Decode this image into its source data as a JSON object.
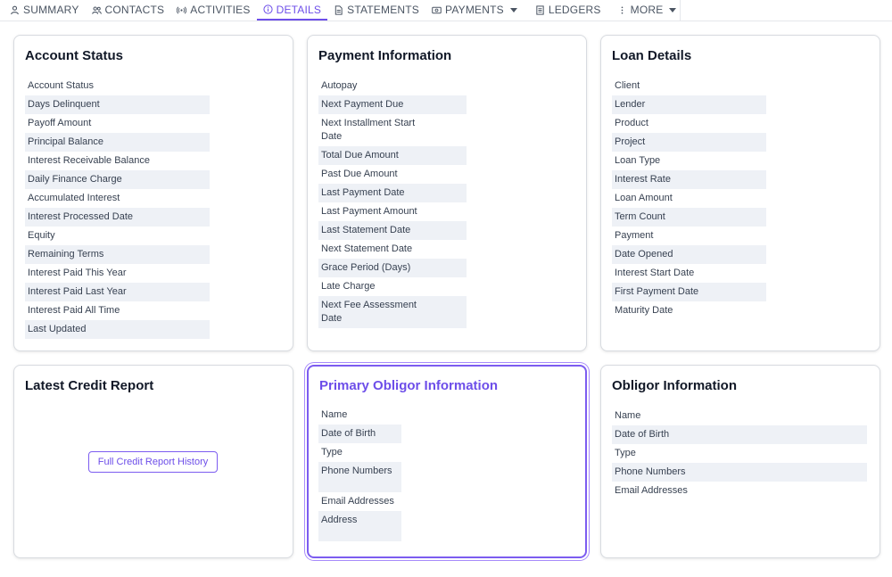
{
  "nav": {
    "tabs": [
      {
        "label": "SUMMARY"
      },
      {
        "label": "CONTACTS"
      },
      {
        "label": "ACTIVITIES"
      },
      {
        "label": "DETAILS"
      },
      {
        "label": "STATEMENTS"
      },
      {
        "label": "PAYMENTS"
      },
      {
        "label": "LEDGERS"
      },
      {
        "label": "MORE"
      }
    ]
  },
  "account_status": {
    "title": "Account Status",
    "fields": [
      "Account Status",
      "Days Delinquent",
      "Payoff Amount",
      "Principal Balance",
      "Interest Receivable Balance",
      "Daily Finance Charge",
      "Accumulated Interest",
      "Interest Processed Date",
      "Equity",
      "Remaining Terms",
      "Interest Paid This Year",
      "Interest Paid Last Year",
      "Interest Paid All Time",
      "Last Updated"
    ]
  },
  "payment_information": {
    "title": "Payment Information",
    "fields": [
      "Autopay",
      "Next Payment Due",
      "Next Installment Start Date",
      "Total Due Amount",
      "Past Due Amount",
      "Last Payment Date",
      "Last Payment Amount",
      "Last Statement Date",
      "Next Statement Date",
      "Grace Period (Days)",
      "Late Charge",
      "Next Fee Assessment Date"
    ]
  },
  "loan_details": {
    "title": "Loan Details",
    "fields": [
      "Client",
      "Lender",
      "Product",
      "Project",
      "Loan Type",
      "Interest Rate",
      "Loan Amount",
      "Term Count",
      "Payment",
      "Date Opened",
      "Interest Start Date",
      "First Payment Date",
      "Maturity Date"
    ]
  },
  "latest_credit_report": {
    "title": "Latest Credit Report",
    "button_label": "Full Credit Report History"
  },
  "primary_obligor": {
    "title": "Primary Obligor Information",
    "fields": [
      "Name",
      "Date of Birth",
      "Type",
      "Phone Numbers",
      "Email Addresses",
      "Address"
    ]
  },
  "obligor_information": {
    "title": "Obligor Information",
    "fields": [
      "Name",
      "Date of Birth",
      "Type",
      "Phone Numbers",
      "Email Addresses"
    ]
  },
  "colors": {
    "accent": "#6d4ee9",
    "stripe": "#eef1f6",
    "border": "#d8dbe0"
  }
}
